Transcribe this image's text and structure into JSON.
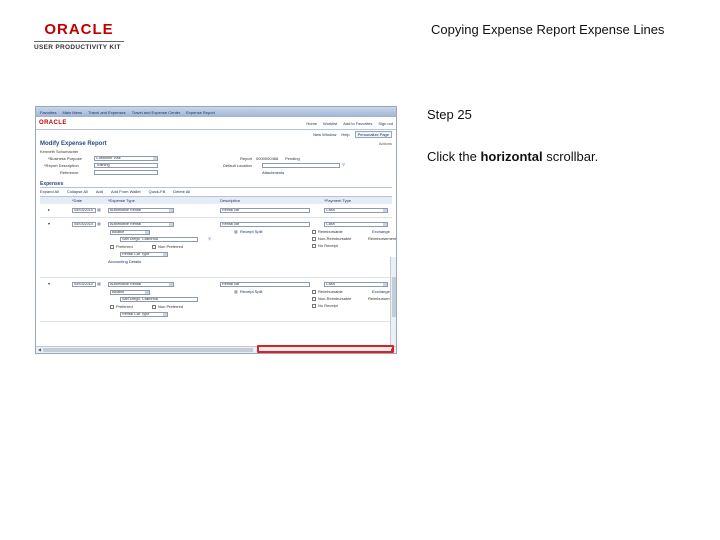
{
  "logo": {
    "brand": "ORACLE",
    "product": "USER PRODUCTIVITY KIT"
  },
  "slide": {
    "title": "Copying Expense Report Expense Lines",
    "step": "Step 25",
    "instruction_prefix": "Click the ",
    "instruction_bold": "horizontal",
    "instruction_suffix": " scrollbar."
  },
  "app": {
    "nav": [
      "Favorites",
      "Main Menu",
      "Travel and Expenses",
      "Travel and Expense Center",
      "Expense Report"
    ],
    "brand": "ORACLE",
    "header_links": [
      "Home",
      "Worklist",
      "Add to Favorites",
      "Sign out"
    ],
    "new_window": "New Window",
    "help": "Help",
    "personalize": "Personalize Page",
    "page_title": "Modify Expense Report",
    "page_right": "Actions",
    "labels": {
      "employee": "Kenneth Schumacher",
      "business_purpose": "*Business Purpose",
      "report_description": "*Report Description",
      "reference": "Reference",
      "report": "Report",
      "default_location": "Default Location",
      "attachments": "Attachments"
    },
    "values": {
      "business_purpose": "Customer Visit",
      "report_description": "Training",
      "report_id": "0000000468",
      "report_status": "Pending"
    },
    "section_title": "Expenses",
    "tabs": [
      "Expand All",
      "Collapse All",
      "Add",
      "Add From Wallet",
      "Quick-Fill",
      "Delete All"
    ],
    "grid_headers": [
      "*Date",
      "*Expense Type",
      "Description",
      "*Payment Type"
    ],
    "rows": [
      {
        "date": "05/03/2010",
        "type": "Automobile Rental",
        "desc": "Rental car",
        "pay": "Cash"
      },
      {
        "date": "05/03/2010",
        "type": "Automobile Rental",
        "desc": "Rental car",
        "pay": "Cash",
        "billing_type": "Billable",
        "transaction_location": "San Diego, California",
        "rate": "Preferred",
        "non_preferred": "Non Preferred",
        "detail1": "Rental Car Type",
        "accounting_details": "Accounting Details",
        "receipt_split": "Receipt Split",
        "flags": [
          "Reimbursable",
          "Non-Reimbursable",
          "No Receipt"
        ],
        "exchange_label": "Exchange",
        "reimbursement": "Reimbursement"
      },
      {
        "date": "05/03/2010",
        "type": "Automobile Rental",
        "desc": "Rental car",
        "pay": "Cash",
        "billing_type": "Billable",
        "transaction_location": "San Diego, California",
        "rate": "Preferred",
        "non_preferred": "Non Preferred",
        "detail1": "Rental Car Type",
        "receipt_split": "Receipt Split",
        "flags": [
          "Reimbursable",
          "Non-Reimbursable",
          "No Receipt"
        ],
        "exchange_label": "Exchange",
        "reimbursement": "Reimbursement"
      }
    ]
  }
}
